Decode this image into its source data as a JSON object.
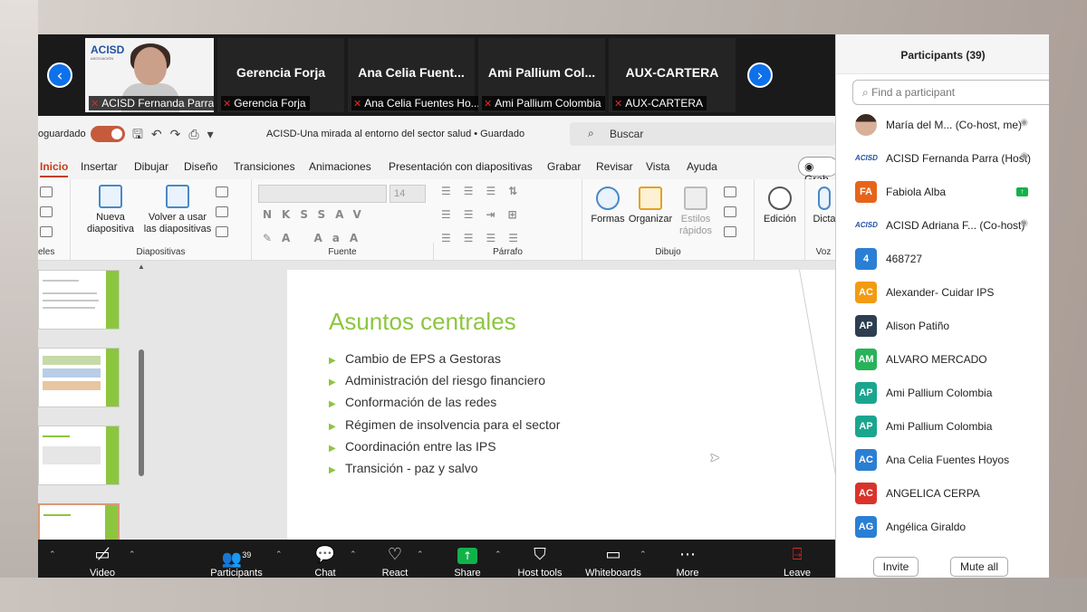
{
  "gallery": {
    "prev_icon": "‹",
    "next_icon": "›",
    "self_tile": {
      "label": "ACISD Fernanda Parra",
      "logo": "ACISD"
    },
    "tiles": [
      {
        "name": "Gerencia Forja",
        "label": "Gerencia Forja"
      },
      {
        "name": "Ana Celia Fuent...",
        "label": "Ana Celia Fuentes Ho..."
      },
      {
        "name": "Ami Pallium Col...",
        "label": "Ami Pallium Colombia"
      },
      {
        "name": "AUX-CARTERA",
        "label": "AUX-CARTERA"
      }
    ]
  },
  "ppt": {
    "autosave": "oguardado",
    "doc_title": "ACISD-Una mirada al entorno del sector salud  •  Guardado",
    "search_placeholder": "Buscar",
    "tabs": [
      "Inicio",
      "Insertar",
      "Dibujar",
      "Diseño",
      "Transiciones",
      "Animaciones",
      "Presentación con diapositivas",
      "Grabar",
      "Revisar",
      "Vista",
      "Ayuda"
    ],
    "record_label": "Grab",
    "ribbon": {
      "group_portapapeles": "eles",
      "group_diapositivas": "Diapositivas",
      "nueva_diapositiva": "Nueva diapositiva",
      "volver_usar": "Volver a usar las diapositivas",
      "group_fuente": "Fuente",
      "font_size": "14",
      "group_parrafo": "Párrafo",
      "group_dibujo": "Dibujo",
      "formas": "Formas",
      "organizar": "Organizar",
      "estilos_rapidos": "Estilos rápidos",
      "edicion": "Edición",
      "dictar": "Dicta",
      "group_voz": "Voz"
    },
    "slide": {
      "title": "Asuntos centrales",
      "bullets": [
        "Cambio de EPS a Gestoras",
        "Administración del riesgo financiero",
        "Conformación de las redes",
        "Régimen de insolvencia para el sector",
        "Coordinación entre las IPS",
        "Transición - paz y salvo"
      ]
    }
  },
  "toolbar": {
    "video": "Video",
    "participants": "Participants",
    "participants_count": "39",
    "chat": "Chat",
    "react": "React",
    "share": "Share",
    "host_tools": "Host tools",
    "whiteboards": "Whiteboards",
    "more": "More",
    "leave": "Leave"
  },
  "participants_panel": {
    "title": "Participants (39)",
    "search_placeholder": "Find a participant",
    "invite": "Invite",
    "mute_all": "Mute all",
    "items": [
      {
        "avatar": "",
        "name": "María del M...  (Co-host, me)",
        "avatar_color": "#000000",
        "type": "photo"
      },
      {
        "avatar": "ACISD",
        "name": "ACISD Fernanda Parra (Host)",
        "avatar_color": "#ffffff",
        "type": "logo"
      },
      {
        "avatar": "FA",
        "name": "Fabiola Alba",
        "avatar_color": "#e8631a",
        "type": "initials",
        "share": true
      },
      {
        "avatar": "ACISD",
        "name": "ACISD Adriana F...  (Co-host)",
        "avatar_color": "#ffffff",
        "type": "logo"
      },
      {
        "avatar": "4",
        "name": "468727",
        "avatar_color": "#2a7fd4",
        "type": "initials"
      },
      {
        "avatar": "AC",
        "name": "Alexander- Cuidar IPS",
        "avatar_color": "#f29b12",
        "type": "initials"
      },
      {
        "avatar": "AP",
        "name": "Alison Patiño",
        "avatar_color": "#2d3e50",
        "type": "initials"
      },
      {
        "avatar": "AM",
        "name": "ALVARO MERCADO",
        "avatar_color": "#27b35a",
        "type": "initials"
      },
      {
        "avatar": "AP",
        "name": "Ami Pallium Colombia",
        "avatar_color": "#1aa68e",
        "type": "initials"
      },
      {
        "avatar": "AP",
        "name": "Ami Pallium Colombia",
        "avatar_color": "#1aa68e",
        "type": "initials"
      },
      {
        "avatar": "AC",
        "name": "Ana Celia Fuentes Hoyos",
        "avatar_color": "#2a7fd4",
        "type": "initials"
      },
      {
        "avatar": "AC",
        "name": "ANGELICA CERPA",
        "avatar_color": "#d9342b",
        "type": "initials"
      },
      {
        "avatar": "AG",
        "name": "Angélica Giraldo",
        "avatar_color": "#2a7fd4",
        "type": "initials"
      }
    ]
  }
}
